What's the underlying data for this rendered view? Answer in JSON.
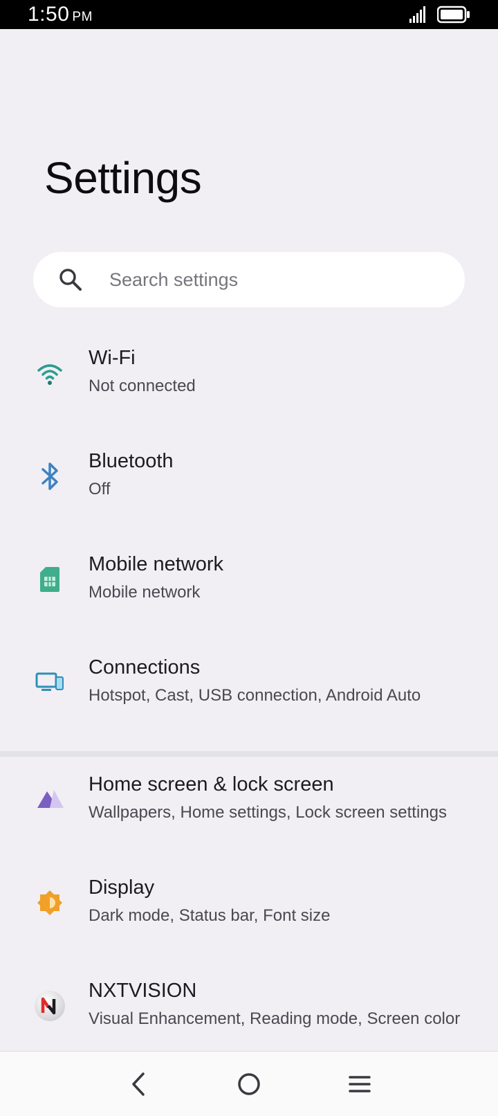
{
  "status_bar": {
    "time": "1:50",
    "ampm": "PM"
  },
  "title": "Settings",
  "search": {
    "placeholder": "Search settings"
  },
  "items": [
    {
      "title": "Wi-Fi",
      "subtitle": "Not connected",
      "icon": "wifi-icon",
      "color": "#2a9d8f"
    },
    {
      "title": "Bluetooth",
      "subtitle": "Off",
      "icon": "bluetooth-icon",
      "color": "#3b82c4"
    },
    {
      "title": "Mobile network",
      "subtitle": "Mobile network",
      "icon": "sim-card-icon",
      "color": "#3fae8a"
    },
    {
      "title": "Connections",
      "subtitle": "Hotspot, Cast, USB connection, Android Auto",
      "icon": "devices-icon",
      "color": "#2f8fb8"
    },
    {
      "title": "Home screen & lock screen",
      "subtitle": "Wallpapers, Home settings, Lock screen settings",
      "icon": "wallpaper-icon",
      "color": "#7b5fc1"
    },
    {
      "title": "Display",
      "subtitle": "Dark mode, Status bar, Font size",
      "icon": "brightness-icon",
      "color": "#f0a028"
    },
    {
      "title": "NXTVISION",
      "subtitle": "Visual Enhancement, Reading mode, Screen color",
      "icon": "nxtvision-icon",
      "color": "#e02a2a"
    }
  ]
}
